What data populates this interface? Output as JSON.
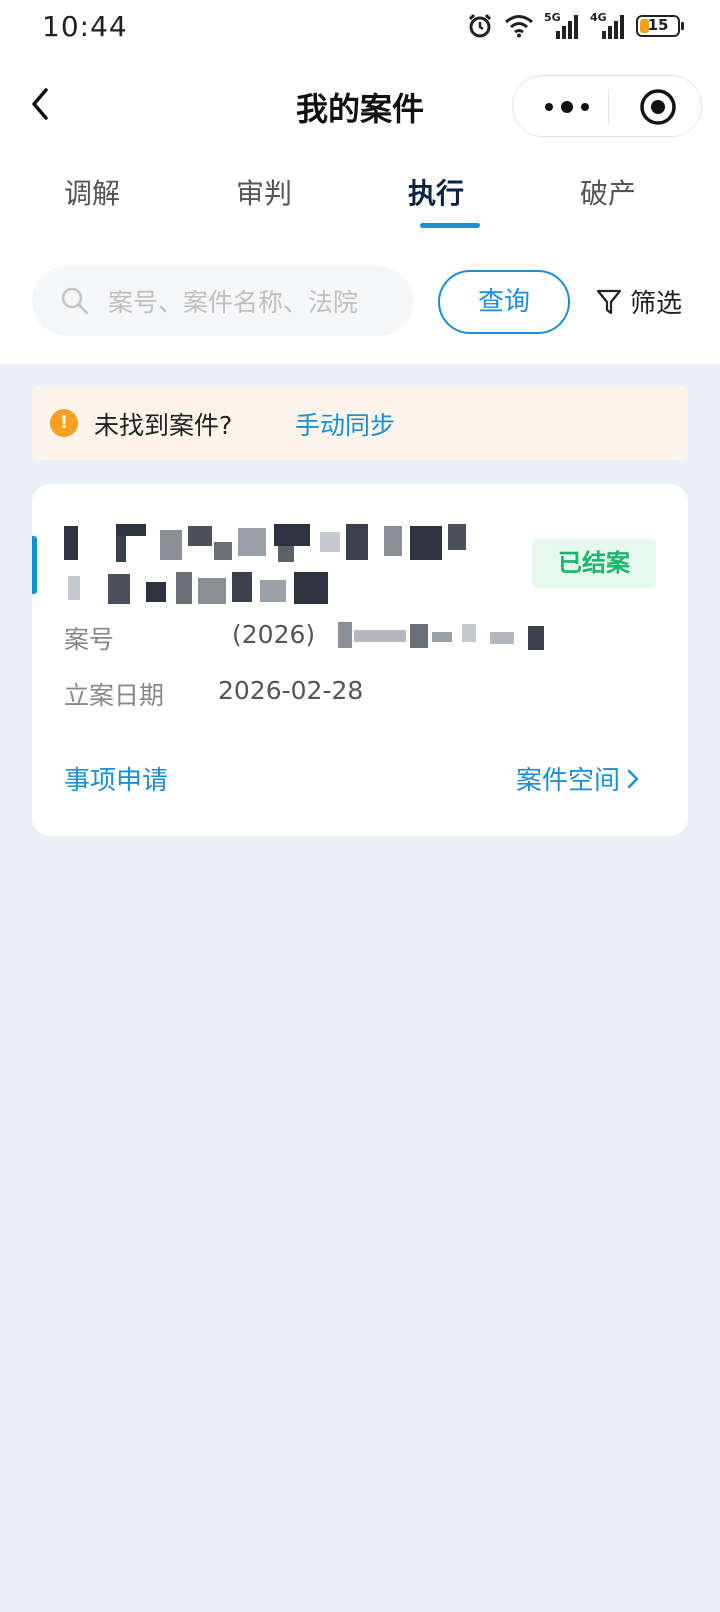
{
  "status_bar": {
    "time": "10:44",
    "net1": "5G",
    "net2": "4G",
    "battery": "15"
  },
  "header": {
    "title": "我的案件"
  },
  "tabs": [
    {
      "label": "调解"
    },
    {
      "label": "审判"
    },
    {
      "label": "执行",
      "active": true
    },
    {
      "label": "破产"
    }
  ],
  "search": {
    "placeholder": "案号、案件名称、法院",
    "button": "查询",
    "filter": "筛选"
  },
  "notice": {
    "text": "未找到案件?",
    "link": "手动同步"
  },
  "case": {
    "badge": "已结案",
    "case_no_label": "案号",
    "case_no_value": "(2026)",
    "filing_date_label": "立案日期",
    "filing_date_value": "2026-02-28",
    "apply_link": "事项申请",
    "space_link": "案件空间"
  },
  "colors": {
    "accent": "#1a8fd6",
    "badge_green": "#1bb56c",
    "warning": "#f7a021",
    "page_bg": "#ebf0f7"
  }
}
